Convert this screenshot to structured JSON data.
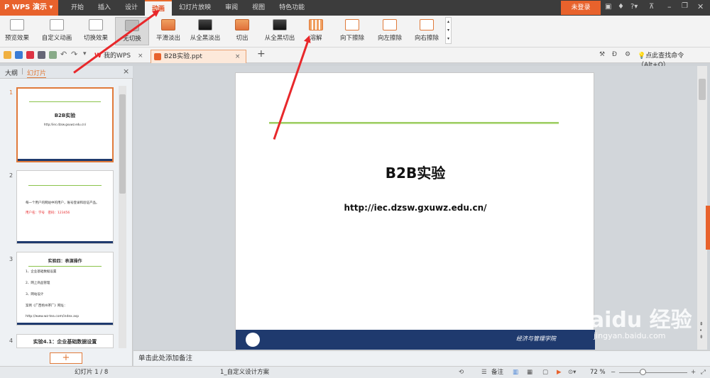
{
  "app": {
    "name": "WPS 演示",
    "login": "未登录"
  },
  "tabs": [
    {
      "label": "开始"
    },
    {
      "label": "插入"
    },
    {
      "label": "设计"
    },
    {
      "label": "动画",
      "active": true
    },
    {
      "label": "幻灯片放映"
    },
    {
      "label": "审阅"
    },
    {
      "label": "视图"
    },
    {
      "label": "特色功能"
    }
  ],
  "ribbon": [
    {
      "label": "预览效果",
      "icon": "preview-icon"
    },
    {
      "label": "自定义动画",
      "icon": "custom-animation-icon"
    },
    {
      "label": "切换效果",
      "icon": "transition-icon"
    },
    {
      "label": "无切换",
      "icon": "no-transition-icon",
      "selected": true
    },
    {
      "label": "平滑淡出",
      "icon": "fade-smooth-icon"
    },
    {
      "label": "从全黑淡出",
      "icon": "fade-black-icon"
    },
    {
      "label": "切出",
      "icon": "cut-icon"
    },
    {
      "label": "从全黑切出",
      "icon": "cut-black-icon"
    },
    {
      "label": "溶解",
      "icon": "dissolve-icon"
    },
    {
      "label": "向下擦除",
      "icon": "wipe-down-icon"
    },
    {
      "label": "向左擦除",
      "icon": "wipe-left-icon"
    },
    {
      "label": "向右擦除",
      "icon": "wipe-right-icon"
    }
  ],
  "quickbar": {
    "mywps": "我的WPS",
    "doc": "B2B实验.ppt",
    "search": "点此查找命令（Alt+Q）"
  },
  "panel": {
    "outline": "大纲",
    "slides": "幻灯片"
  },
  "thumbs": {
    "t1": {
      "title": "B2B实验",
      "url": "http://iec.dzsw.gxuwz.edu.cn/"
    },
    "t2": {
      "line1": "每一个用户的网站中的用户，账号登录和验证产品。",
      "line2": "用户名：学号　密码：123456"
    },
    "t3": {
      "title": "实验四：表演操作",
      "items": [
        "1、企业基础数据设置",
        "2、网上商品管理",
        "3、网站设计",
        "案例《广西梧州茶厂》网址：",
        "http://www.wz-tea.com/index.asp"
      ]
    },
    "t4": {
      "title": "实验4.1：企业基础数据设置"
    },
    "numbers": [
      "1",
      "2",
      "3",
      "4"
    ]
  },
  "slide": {
    "title": "B2B实验",
    "url": "http://iec.dzsw.gxuwz.edu.cn/",
    "footer": "经济与管理学院"
  },
  "notes": "单击此处添加备注",
  "status": {
    "slide": "幻灯片 1 / 8",
    "scheme": "1_自定义设计方案",
    "notes_btn": "备注",
    "zoom": "72 %"
  },
  "watermark": {
    "brand": "Baidu 经验",
    "url": "jingyan.baidu.com"
  },
  "colors": {
    "accent": "#e8622c",
    "arrow": "#e8282b",
    "footer_band": "#1f3a6e",
    "green_line": "#8bc34a"
  }
}
